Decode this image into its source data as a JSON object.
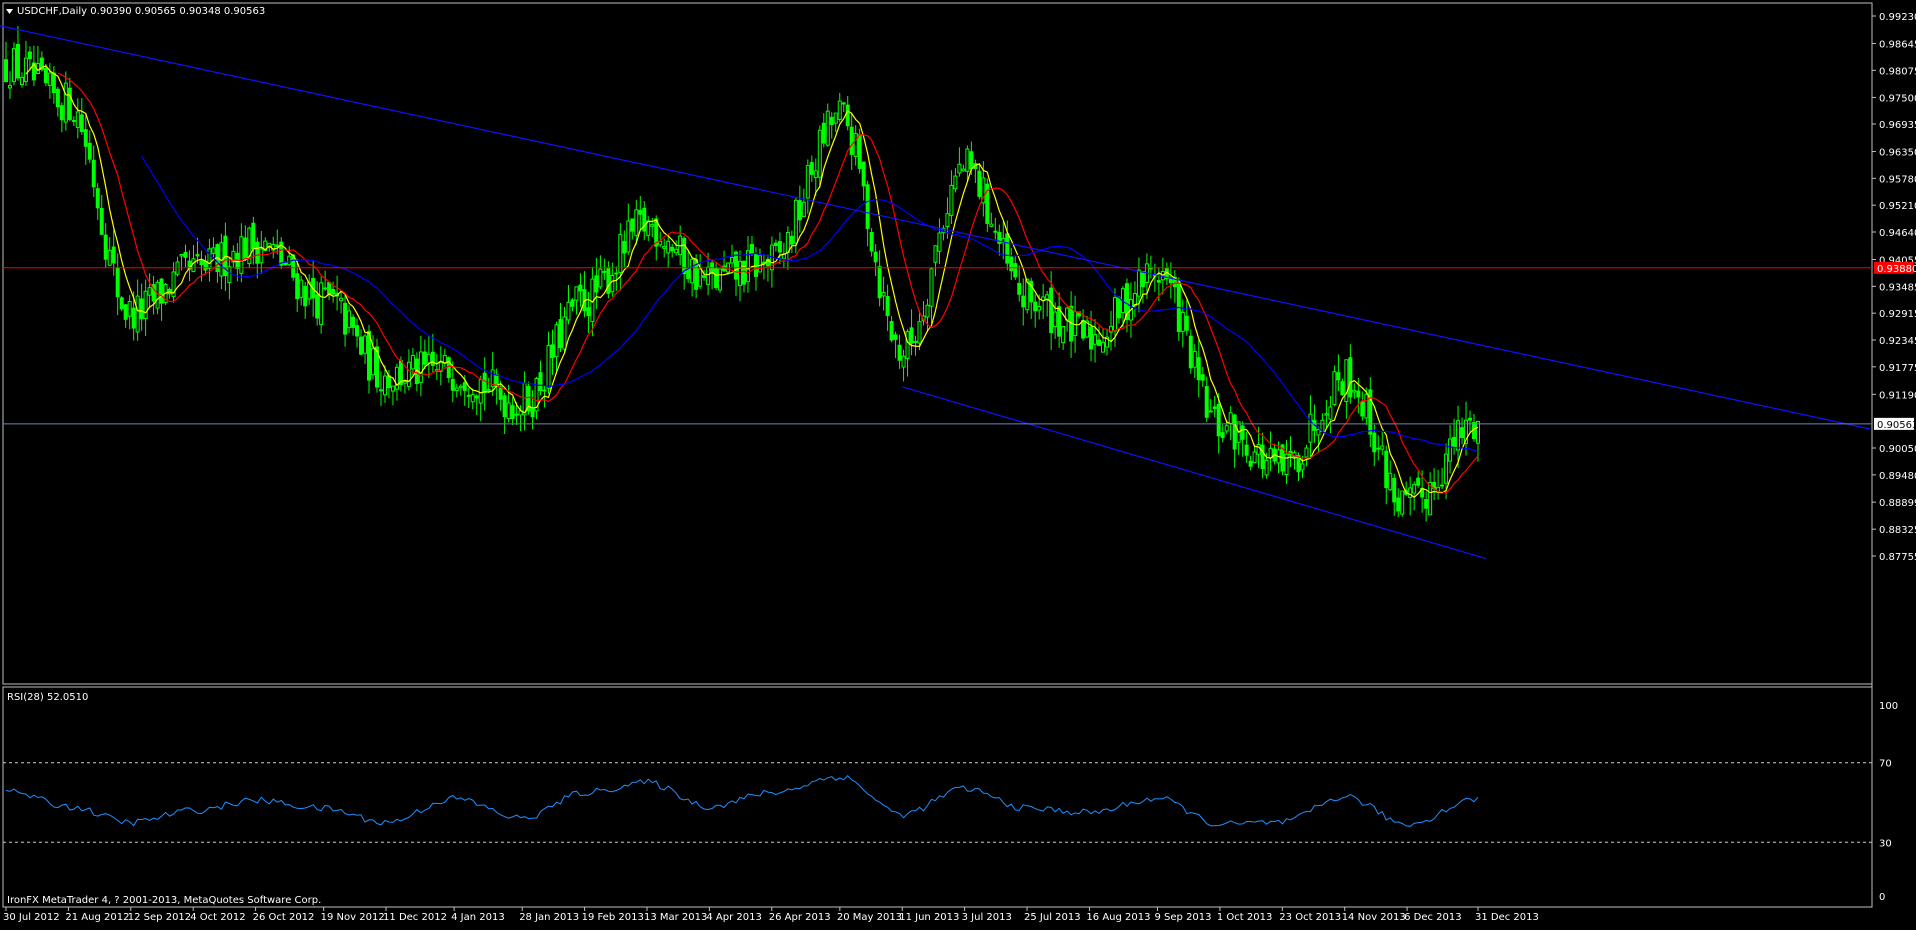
{
  "main_chart": {
    "menu_arrow": "triangle-down-icon",
    "header_text": "USDCHF,Daily  0.90390 0.90565 0.90348 0.90563",
    "price_axis_labels": [
      "0.99230",
      "0.98645",
      "0.98075",
      "0.97500",
      "0.96935",
      "0.96350",
      "0.95780",
      "0.95210",
      "0.94640",
      "0.94055",
      "0.93485",
      "0.92915",
      "0.92345",
      "0.91775",
      "0.91190",
      "0.90050",
      "0.89480",
      "0.88899",
      "0.88325",
      "0.87755"
    ],
    "red_level_tag": "0.93880",
    "current_price_tag": "0.90563",
    "colors": {
      "background": "#000000",
      "candle": "#00ff00",
      "ma_fast": "#ffff00",
      "ma_mid": "#ff0000",
      "ma_slow": "#0000ff",
      "channel": "#1010ff",
      "red_level": "#ff0000",
      "current_price_line": "#6f86b8"
    }
  },
  "rsi_panel": {
    "header_text": "RSI(28) 52.0510",
    "axis_labels": {
      "top": "100",
      "upper": "70",
      "lower": "30",
      "bottom": "0"
    },
    "line_color": "#1e90ff"
  },
  "footer": {
    "copyright": "IronFX MetaTrader 4, ? 2001-2013, MetaQuotes Software Corp."
  },
  "time_axis": {
    "labels": [
      "30 Jul 2012",
      "21 Aug 2012",
      "12 Sep 2012",
      "4 Oct 2012",
      "26 Oct 2012",
      "19 Nov 2012",
      "11 Dec 2012",
      "4 Jan 2013",
      "28 Jan 2013",
      "19 Feb 2013",
      "13 Mar 2013",
      "4 Apr 2013",
      "26 Apr 2013",
      "20 May 2013",
      "11 Jun 2013",
      "3 Jul 2013",
      "25 Jul 2013",
      "16 Aug 2013",
      "9 Sep 2013",
      "1 Oct 2013",
      "23 Oct 2013",
      "14 Nov 2013",
      "6 Dec 2013",
      "31 Dec 2013"
    ]
  },
  "chart_data": {
    "type": "candlestick",
    "symbol": "USDCHF",
    "timeframe": "Daily",
    "last_bar": {
      "open": 0.9039,
      "high": 0.90565,
      "low": 0.90348,
      "close": 0.90563
    },
    "ylim": [
      0.87755,
      0.9923
    ],
    "horizontal_level": 0.9388,
    "current_price": 0.90563,
    "price_path": [
      [
        "30 Jul 2012",
        0.982
      ],
      [
        "21 Aug 2012",
        0.974
      ],
      [
        "12 Sep 2012",
        0.929
      ],
      [
        "4 Oct 2012",
        0.938
      ],
      [
        "26 Oct 2012",
        0.944
      ],
      [
        "19 Nov 2012",
        0.932
      ],
      [
        "11 Dec 2012",
        0.916
      ],
      [
        "4 Jan 2013",
        0.917
      ],
      [
        "28 Jan 2013",
        0.91
      ],
      [
        "19 Feb 2013",
        0.932
      ],
      [
        "13 Mar 2013",
        0.948
      ],
      [
        "4 Apr 2013",
        0.936
      ],
      [
        "26 Apr 2013",
        0.94
      ],
      [
        "20 May 2013",
        0.971
      ],
      [
        "11 Jun 2013",
        0.921
      ],
      [
        "3 Jul 2013",
        0.96
      ],
      [
        "25 Jul 2013",
        0.932
      ],
      [
        "16 Aug 2013",
        0.924
      ],
      [
        "9 Sep 2013",
        0.938
      ],
      [
        "1 Oct 2013",
        0.905
      ],
      [
        "23 Oct 2013",
        0.896
      ],
      [
        "14 Nov 2013",
        0.916
      ],
      [
        "6 Dec 2013",
        0.888
      ],
      [
        "31 Dec 2013",
        0.906
      ]
    ],
    "channel": {
      "upper": {
        "from": [
          "12 Jul 2012",
          0.9923
        ],
        "to": [
          "31 Dec 2013",
          0.9225
        ]
      },
      "lower": {
        "from": [
          "11 Jun 2013",
          0.9135
        ],
        "to": [
          "31 Dec 2013",
          0.8775
        ]
      }
    },
    "rsi": {
      "period": 28,
      "value": 52.051,
      "ylim": [
        0,
        100
      ],
      "levels": [
        30,
        70
      ],
      "path": [
        [
          "30 Jul 2012",
          56
        ],
        [
          "21 Aug 2012",
          48
        ],
        [
          "12 Sep 2012",
          40
        ],
        [
          "4 Oct 2012",
          46
        ],
        [
          "26 Oct 2012",
          51
        ],
        [
          "19 Nov 2012",
          47
        ],
        [
          "11 Dec 2012",
          40
        ],
        [
          "4 Jan 2013",
          52
        ],
        [
          "28 Jan 2013",
          42
        ],
        [
          "19 Feb 2013",
          55
        ],
        [
          "13 Mar 2013",
          60
        ],
        [
          "4 Apr 2013",
          48
        ],
        [
          "26 Apr 2013",
          55
        ],
        [
          "20 May 2013",
          63
        ],
        [
          "11 Jun 2013",
          44
        ],
        [
          "3 Jul 2013",
          57
        ],
        [
          "25 Jul 2013",
          47
        ],
        [
          "16 Aug 2013",
          45
        ],
        [
          "9 Sep 2013",
          52
        ],
        [
          "1 Oct 2013",
          39
        ],
        [
          "23 Oct 2013",
          40
        ],
        [
          "14 Nov 2013",
          53
        ],
        [
          "6 Dec 2013",
          39
        ],
        [
          "31 Dec 2013",
          52
        ]
      ]
    }
  }
}
